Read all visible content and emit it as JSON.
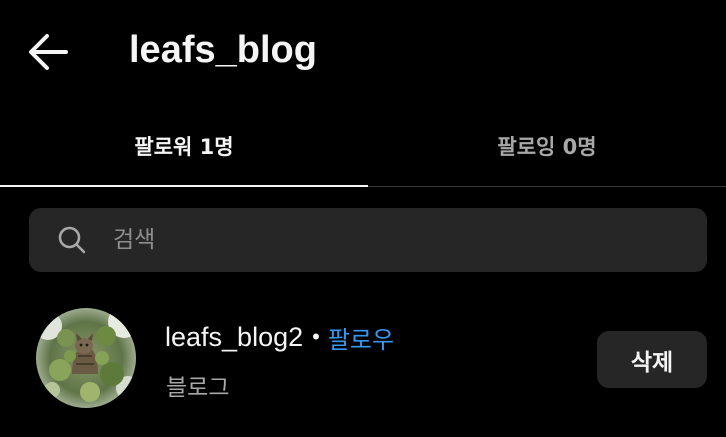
{
  "header": {
    "title": "leafs_blog",
    "back_icon": "arrow-left-icon"
  },
  "tabs": [
    {
      "label": "팔로워 1명",
      "active": true
    },
    {
      "label": "팔로잉 0명",
      "active": false
    }
  ],
  "search": {
    "placeholder": "검색",
    "value": "",
    "icon": "search-icon"
  },
  "followers": [
    {
      "username": "leafs_blog2",
      "separator": "•",
      "follow_label": "팔로우",
      "subtitle": "블로그",
      "remove_label": "삭제",
      "avatar_icon": "avatar"
    }
  ],
  "colors": {
    "background": "#000000",
    "text": "#f5f5f5",
    "secondary_text": "#a8a8a8",
    "link": "#3897f0",
    "surface": "#262626",
    "divider": "#363636"
  }
}
